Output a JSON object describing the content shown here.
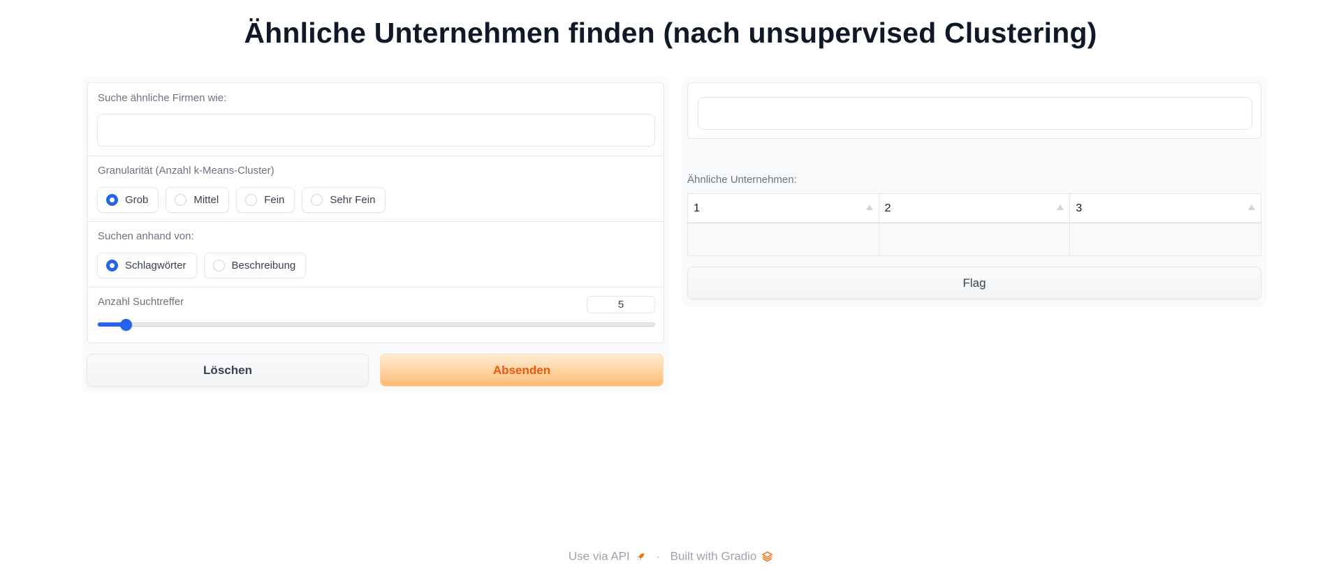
{
  "page": {
    "title": "Ähnliche Unternehmen finden (nach unsupervised Clustering)"
  },
  "left": {
    "search": {
      "label": "Suche ähnliche Firmen wie:",
      "value": "",
      "placeholder": ""
    },
    "granularity": {
      "label": "Granularität (Anzahl k-Means-Cluster)",
      "options": [
        "Grob",
        "Mittel",
        "Fein",
        "Sehr Fein"
      ],
      "selected": "Grob"
    },
    "search_by": {
      "label": "Suchen anhand von:",
      "options": [
        "Schlagwörter",
        "Beschreibung"
      ],
      "selected": "Schlagwörter"
    },
    "hits": {
      "label": "Anzahl Suchtreffer",
      "value": "5",
      "slider_fraction": 0.05
    },
    "clear_label": "Löschen",
    "submit_label": "Absenden"
  },
  "right": {
    "output_value": "",
    "table": {
      "label": "Ähnliche Unternehmen:",
      "headers": [
        "1",
        "2",
        "3"
      ],
      "rows": [
        [
          "",
          "",
          ""
        ]
      ]
    },
    "flag_label": "Flag"
  },
  "footer": {
    "api_label": "Use via API",
    "separator": "·",
    "built_label": "Built with Gradio"
  },
  "colors": {
    "accent": "#2563eb",
    "primary_text": "#ea580c",
    "primary_bg": "#fdba74"
  },
  "icons": {
    "api": "rocket-icon",
    "gradio": "gradio-logo-icon",
    "sort": "sort-arrow-icon"
  }
}
